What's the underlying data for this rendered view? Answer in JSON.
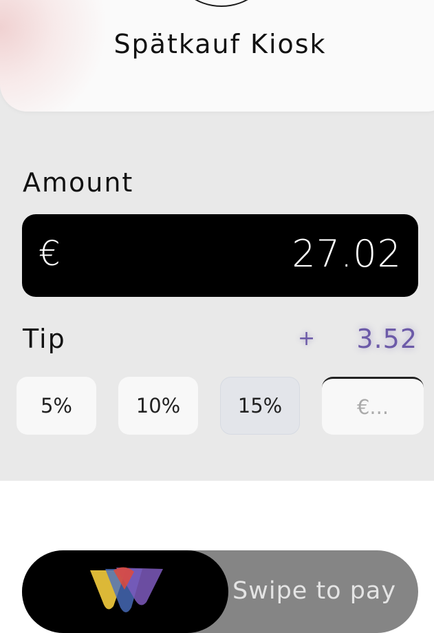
{
  "header": {
    "store_name": "Spätkauf Kiosk"
  },
  "amount": {
    "label": "Amount",
    "currency_symbol": "€",
    "value": "27.02"
  },
  "tip": {
    "label": "Tip",
    "plus_sign": "+",
    "value": "3.52",
    "accent_color": "#6c5aa8",
    "options": [
      {
        "label": "5%"
      },
      {
        "label": "10%"
      },
      {
        "label": "15%",
        "selected": true
      }
    ],
    "custom_placeholder": "€..."
  },
  "swipe": {
    "label": "Swipe to pay",
    "icon": "brand-logo-icon"
  }
}
